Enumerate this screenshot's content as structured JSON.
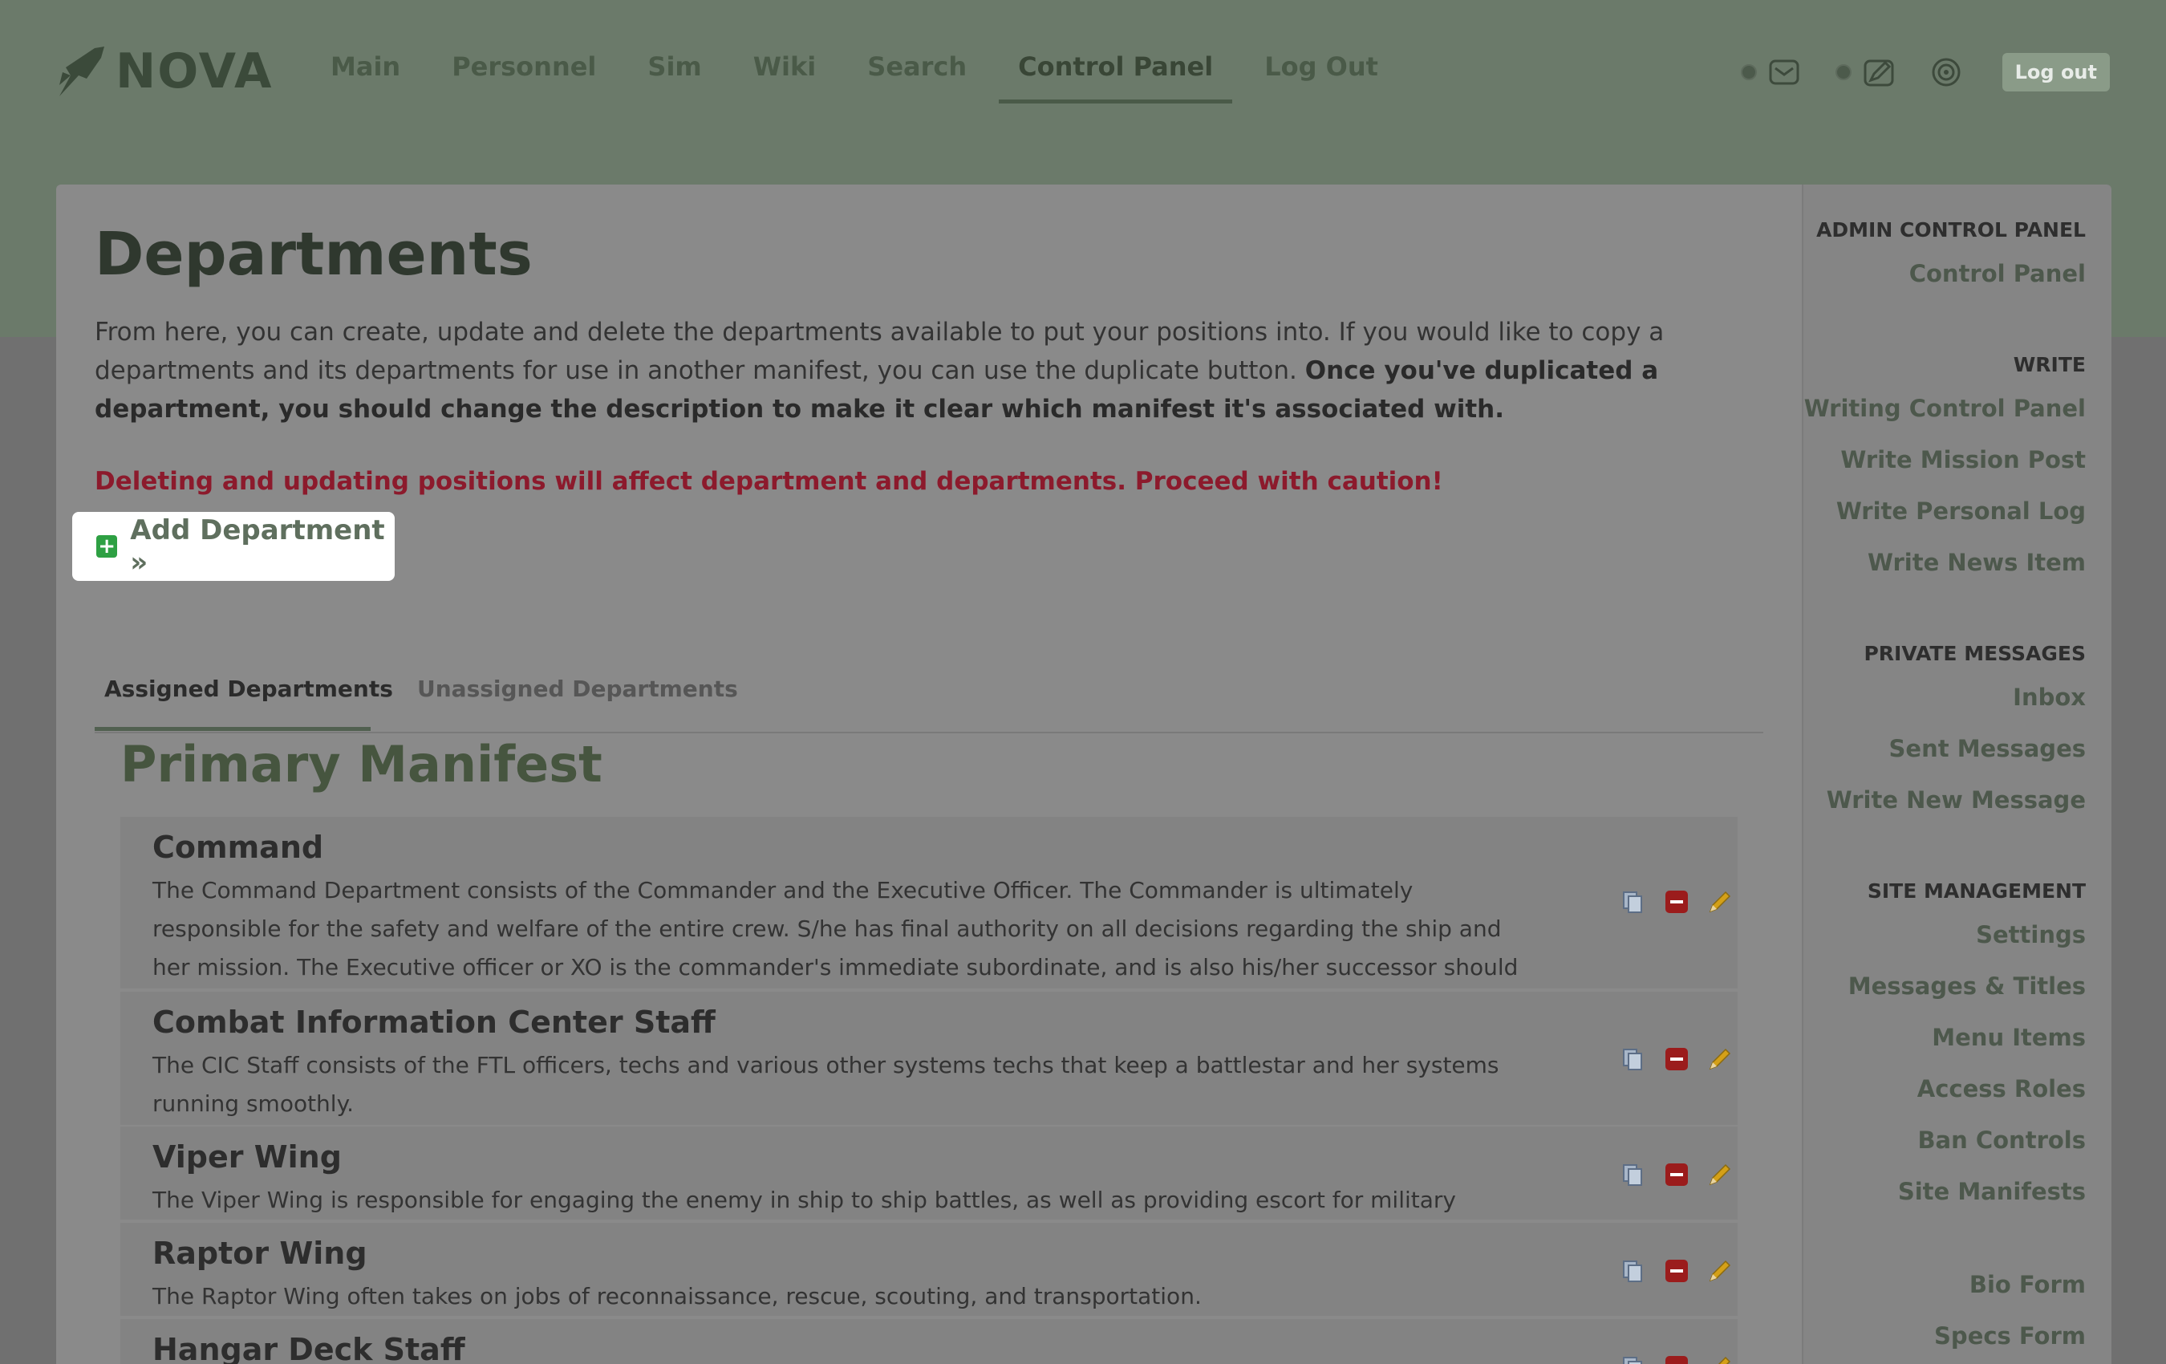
{
  "brand": {
    "name": "NOVA"
  },
  "nav": {
    "items": [
      {
        "label": "Main"
      },
      {
        "label": "Personnel"
      },
      {
        "label": "Sim"
      },
      {
        "label": "Wiki"
      },
      {
        "label": "Search"
      },
      {
        "label": "Control Panel",
        "active": true
      },
      {
        "label": "Log Out"
      }
    ],
    "logout_button": "Log out"
  },
  "page": {
    "title": "Departments",
    "intro_plain": "From here, you can create, update and delete the departments available to put your positions into. If you would like to copy a departments and its departments for use in another manifest, you can use the duplicate button.",
    "intro_bold": "Once you've duplicated a department, you should change the description to make it clear which manifest it's associated with.",
    "warning": "Deleting and updating positions will affect department and departments. Proceed with caution!",
    "add_button": "Add Department »"
  },
  "tabs": [
    {
      "label": "Assigned Departments",
      "active": true
    },
    {
      "label": "Unassigned Departments",
      "active": false
    }
  ],
  "manifest": {
    "title": "Primary Manifest",
    "departments": [
      {
        "name": "Command",
        "description": "The Command Department consists of the Commander and the Executive Officer. The Commander is ultimately responsible for the safety and welfare of the entire crew. S/he has final authority on all decisions regarding the ship and her mission. The Executive officer or XO is the commander's immediate subordinate, and is also his/her successor should the need arise."
      },
      {
        "name": "Combat Information Center Staff",
        "description": "The CIC Staff consists of the FTL officers, techs and various other systems techs that keep a battlestar and her systems running smoothly."
      },
      {
        "name": "Viper Wing",
        "description": "The Viper Wing is responsible for engaging the enemy in ship to ship battles, as well as providing escort for military vessels."
      },
      {
        "name": "Raptor Wing",
        "description": "The Raptor Wing often takes on jobs of reconnaissance, rescue, scouting, and transportation."
      },
      {
        "name": "Hangar Deck Staff",
        "description": ""
      }
    ]
  },
  "sidebar": {
    "sections": [
      {
        "heading": "ADMIN CONTROL PANEL",
        "links": [
          "Control Panel"
        ]
      },
      {
        "heading": "WRITE",
        "links": [
          "Writing Control Panel",
          "Write Mission Post",
          "Write Personal Log",
          "Write News Item"
        ]
      },
      {
        "heading": "PRIVATE MESSAGES",
        "links": [
          "Inbox",
          "Sent Messages",
          "Write New Message"
        ]
      },
      {
        "heading": "SITE MANAGEMENT",
        "links": [
          "Settings",
          "Messages & Titles",
          "Menu Items",
          "Access Roles",
          "Ban Controls",
          "Site Manifests",
          "Bio Form",
          "Specs Form"
        ]
      }
    ]
  },
  "icons": {
    "logo": "nova-rocket-icon",
    "mail": "mail-icon",
    "write": "write-icon",
    "radar": "radar-icon",
    "duplicate": "duplicate-icon",
    "delete": "delete-icon",
    "edit": "pencil-icon"
  },
  "colors": {
    "header": "#6b7a6a",
    "card": "#8a8a8a",
    "warning": "#8c1a2c",
    "manifest_title": "#46553f",
    "add_icon": "#2ea043",
    "delete_icon": "#9b1c1c",
    "edit_icon": "#b8860b"
  }
}
